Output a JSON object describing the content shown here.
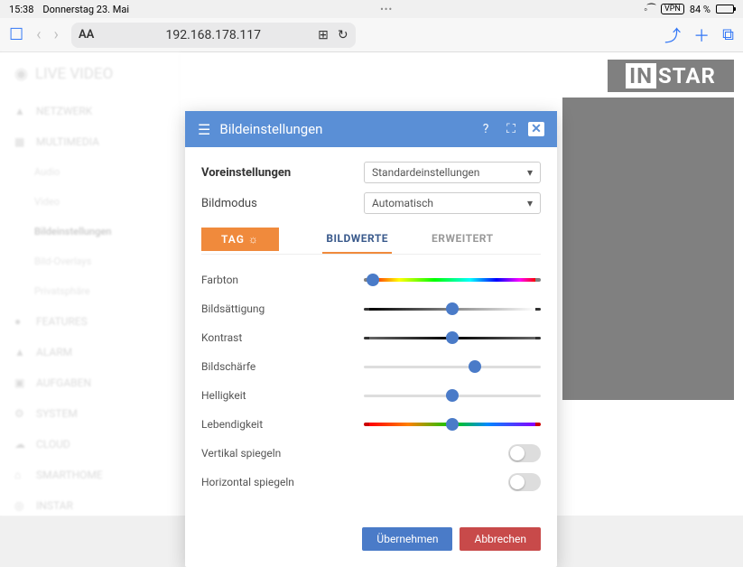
{
  "statusbar": {
    "time": "15:38",
    "date": "Donnerstag 23. Mai",
    "vpn": "VPN",
    "battery": "84 %"
  },
  "browser": {
    "url": "192.168.178.117",
    "aa": "AA"
  },
  "sidebar": {
    "title": "LIVE VIDEO",
    "items": [
      {
        "label": "NETZWERK"
      },
      {
        "label": "MULTIMEDIA"
      },
      {
        "label": "Audio",
        "sub": true
      },
      {
        "label": "Video",
        "sub": true
      },
      {
        "label": "Bildeinstellungen",
        "sub": true,
        "active": true
      },
      {
        "label": "Bild-Overlays",
        "sub": true
      },
      {
        "label": "Privatsphäre",
        "sub": true
      },
      {
        "label": "FEATURES"
      },
      {
        "label": "ALARM"
      },
      {
        "label": "AUFGABEN"
      },
      {
        "label": "SYSTEM"
      },
      {
        "label": "CLOUD"
      },
      {
        "label": "SMARTHOME"
      },
      {
        "label": "INSTAR"
      }
    ]
  },
  "logo": {
    "part1": "IN",
    "part2": "STAR"
  },
  "modal": {
    "title": "Bildeinstellungen",
    "presets_label": "Voreinstellungen",
    "presets_value": "Standardeinstellungen",
    "mode_label": "Bildmodus",
    "mode_value": "Automatisch",
    "tag_btn": "TAG ☼",
    "tabs": {
      "bildwerte": "BILDWERTE",
      "erweitert": "ERWEITERT"
    },
    "sliders": {
      "hue": "Farbton",
      "sat": "Bildsättigung",
      "con": "Kontrast",
      "sharp": "Bildschärfe",
      "bright": "Helligkeit",
      "vib": "Lebendigkeit"
    },
    "toggles": {
      "vflip": "Vertikal spiegeln",
      "hflip": "Horizontal spiegeln"
    },
    "ok": "Übernehmen",
    "cancel": "Abbrechen"
  }
}
